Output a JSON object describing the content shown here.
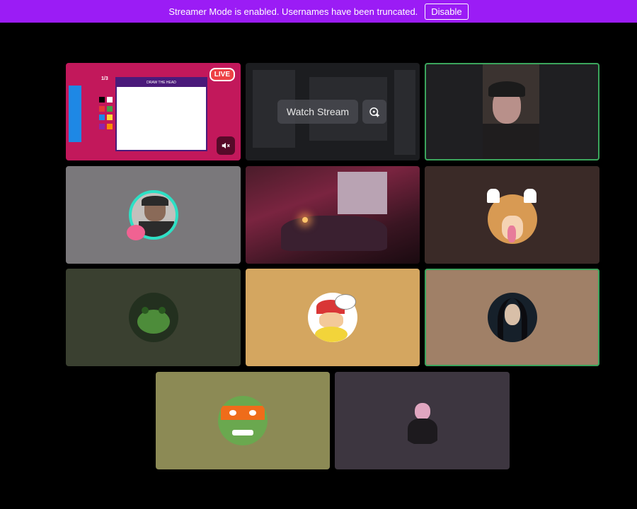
{
  "banner": {
    "message": "Streamer Mode is enabled. Usernames have been truncated.",
    "disable_label": "Disable"
  },
  "stream_tile": {
    "live_label": "LIVE",
    "round_counter": "1/3",
    "game_header": "DRAW THE HEAD",
    "mute_icon": "speaker-muted-icon"
  },
  "watch_tile": {
    "watch_label": "Watch Stream",
    "popout_icon": "popout-stream-icon"
  },
  "colors": {
    "banner_bg": "#9b1cf5",
    "speaking_outline": "#3ba55c",
    "live_red": "#ed4245"
  }
}
